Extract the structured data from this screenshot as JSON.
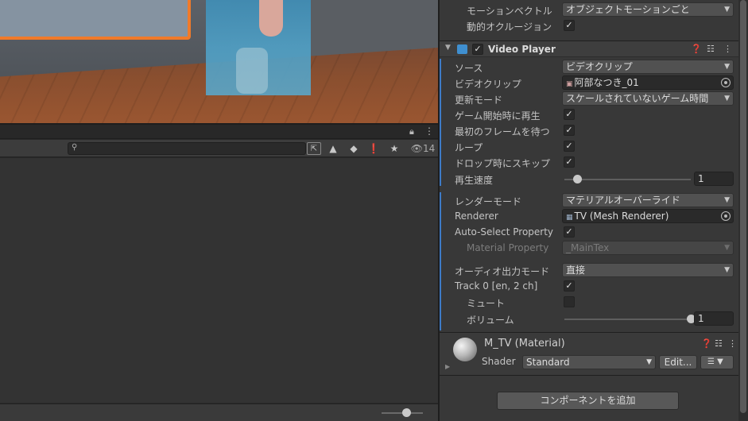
{
  "scene": {
    "description_icons": []
  },
  "lower_panel": {
    "search": {
      "placeholder": ""
    },
    "visibility_count": "14",
    "icons": [
      "lock-icon",
      "kebab-icon",
      "search-icon",
      "scene-pick-icon",
      "filter-type-icon",
      "tag-icon",
      "warning-icon",
      "star-icon",
      "eye-icon"
    ]
  },
  "inspector": {
    "top_rows": [
      {
        "label": "モーションベクトル",
        "value": "オブジェクトモーションごと"
      },
      {
        "label": "動的オクルージョン",
        "checked": true
      }
    ],
    "video_player": {
      "title": "Video Player",
      "enabled": true,
      "source_label": "ソース",
      "source_value": "ビデオクリップ",
      "clip_label": "ビデオクリップ",
      "clip_value": "阿部なつき_01",
      "update_mode_label": "更新モード",
      "update_mode_value": "スケールされていないゲーム時間",
      "play_on_awake_label": "ゲーム開始時に再生",
      "play_on_awake": true,
      "wait_first_frame_label": "最初のフレームを待つ",
      "wait_first_frame": true,
      "loop_label": "ループ",
      "loop": true,
      "skip_on_drop_label": "ドロップ時にスキップ",
      "skip_on_drop": true,
      "playback_speed_label": "再生速度",
      "playback_speed": "1",
      "playback_speed_fraction": 0.1,
      "render_mode_label": "レンダーモード",
      "render_mode_value": "マテリアルオーバーライド",
      "renderer_label": "Renderer",
      "renderer_value": "TV (Mesh Renderer)",
      "auto_select_label": "Auto-Select Property",
      "auto_select": true,
      "material_property_label": "Material Property",
      "material_property_value": "_MainTex",
      "audio_output_label": "オーディオ出力モード",
      "audio_output_value": "直接",
      "track_label": "Track 0 [en, 2 ch]",
      "track_enabled": true,
      "mute_label": "ミュート",
      "mute": false,
      "volume_label": "ボリューム",
      "volume": "1",
      "volume_fraction": 1.0
    },
    "material": {
      "title": "M_TV (Material)",
      "shader_label": "Shader",
      "shader_value": "Standard",
      "edit_label": "Edit..."
    },
    "add_component_label": "コンポーネントを追加"
  },
  "colors": {
    "accent_blue": "#3d7bc7",
    "selection_orange": "#f07a2a"
  }
}
